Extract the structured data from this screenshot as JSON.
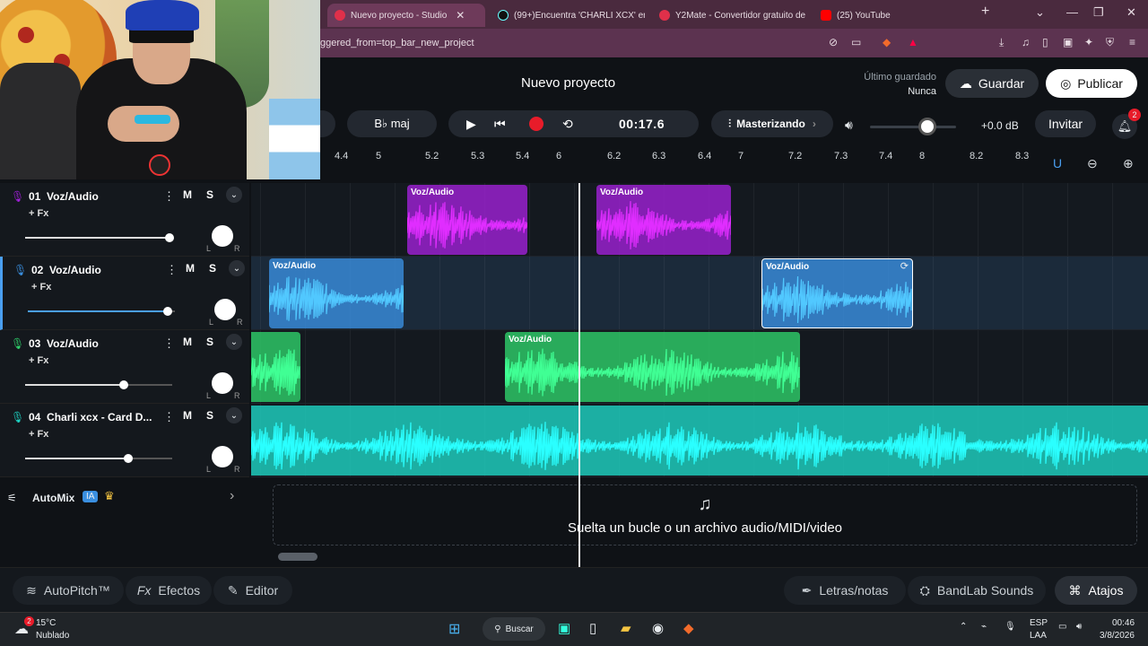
{
  "browser": {
    "tabs": [
      {
        "title": "Nuevo proyecto - Studio",
        "active": true
      },
      {
        "title": "(99+)Encuentra 'CHARLI XCX' en",
        "active": false
      },
      {
        "title": "Y2Mate - Convertidor gratuito de",
        "active": false
      },
      {
        "title": "(25) YouTube",
        "active": false
      }
    ],
    "new_tab": "+",
    "url": "ggered_from=top_bar_new_project"
  },
  "header": {
    "title": "Nuevo proyecto",
    "last_saved_label": "Último guardado",
    "last_saved_value": "Nunca",
    "save_label": "Guardar",
    "publish_label": "Publicar"
  },
  "transport": {
    "key": "B♭ maj",
    "time": "00:17.6",
    "mastering": "Masterizando",
    "volume_db": "+0.0 dB",
    "volume_level": 0.67,
    "invite": "Invitar",
    "notifications": "2"
  },
  "ruler": {
    "ticks": [
      "4.4",
      "5",
      "5.2",
      "5.3",
      "5.4",
      "6",
      "6.2",
      "6.3",
      "6.4",
      "7",
      "7.2",
      "7.3",
      "7.4",
      "8",
      "8.2",
      "8.3"
    ]
  },
  "tracks": [
    {
      "num": "01",
      "name": "Voz/Audio",
      "fx": "+ Fx",
      "mute": "M",
      "solo": "S",
      "color": "#a020d8",
      "volume": 0.98,
      "pan_l": "L",
      "pan_r": "R",
      "clips": [
        {
          "label": "Voz/Audio"
        },
        {
          "label": "Voz/Audio"
        }
      ]
    },
    {
      "num": "02",
      "name": "Voz/Audio",
      "fx": "+ Fx",
      "mute": "M",
      "solo": "S",
      "color": "#3a8fe0",
      "volume": 0.95,
      "pan_l": "L",
      "pan_r": "R",
      "clips": [
        {
          "label": "Voz/Audio"
        },
        {
          "label": "Voz/Audio"
        }
      ]
    },
    {
      "num": "03",
      "name": "Voz/Audio",
      "fx": "+ Fx",
      "mute": "M",
      "solo": "S",
      "color": "#2ed06a",
      "volume": 0.67,
      "pan_l": "L",
      "pan_r": "R",
      "clips": [
        {
          "label": ""
        },
        {
          "label": "Voz/Audio"
        }
      ]
    },
    {
      "num": "04",
      "name": "Charli xcx - Card D...",
      "fx": "+ Fx",
      "mute": "M",
      "solo": "S",
      "color": "#1ed4c4",
      "volume": 0.7,
      "pan_l": "L",
      "pan_r": "R",
      "clips": [
        {
          "label": ""
        }
      ]
    }
  ],
  "automix": {
    "label": "AutoMix",
    "badge": "IA"
  },
  "drop_zone": "Suelta un bucle o un archivo audio/MIDI/video",
  "bottom": {
    "autopitch": "AutoPitch™",
    "effects": "Efectos",
    "effects_prefix": "Fx",
    "editor": "Editor",
    "lyrics": "Letras/notas",
    "sounds": "BandLab Sounds",
    "shortcuts": "Atajos"
  },
  "taskbar": {
    "weather_temp": "15°C",
    "weather_desc": "Nublado",
    "weather_badge": "2",
    "search": "Buscar",
    "lang1": "ESP",
    "lang2": "LAA",
    "time": "00:46",
    "date": "3/8/2026"
  }
}
